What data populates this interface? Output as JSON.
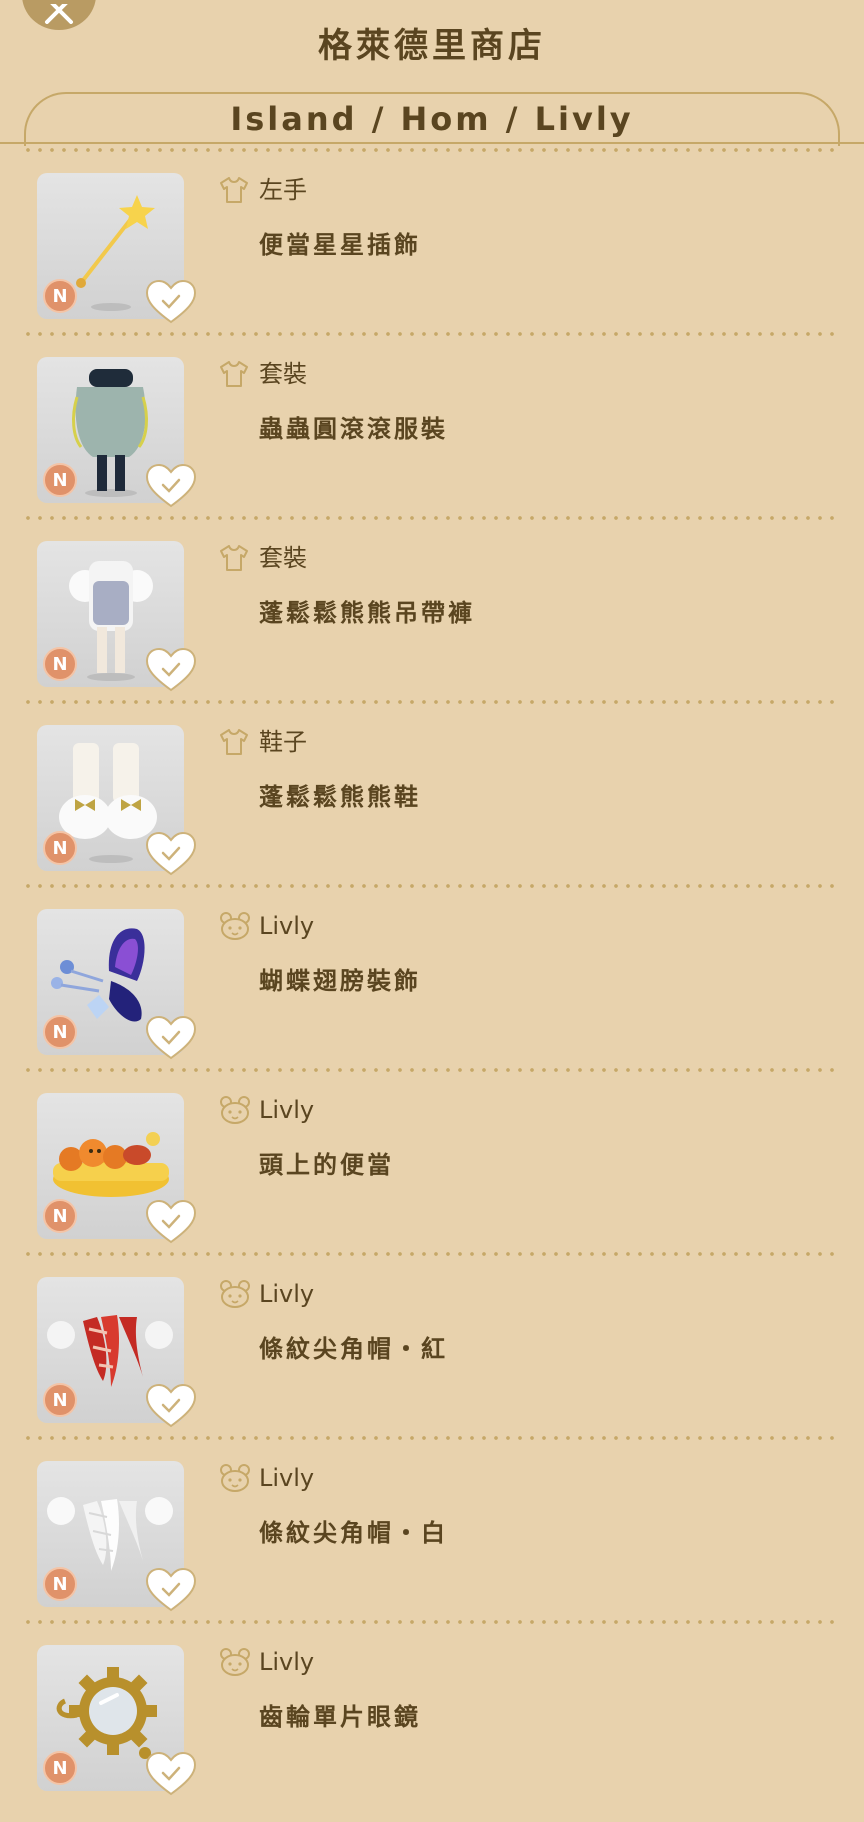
{
  "header": {
    "title": "格萊德里商店",
    "tab_label": "Island / Hom / Livly"
  },
  "rarity_label": "N",
  "items": [
    {
      "category": "左手",
      "category_icon": "shirt-icon",
      "name": "便當星星插飾"
    },
    {
      "category": "套裝",
      "category_icon": "shirt-icon",
      "name": "蟲蟲圓滾滾服裝"
    },
    {
      "category": "套裝",
      "category_icon": "shirt-icon",
      "name": "蓬鬆鬆熊熊吊帶褲"
    },
    {
      "category": "鞋子",
      "category_icon": "shirt-icon",
      "name": "蓬鬆鬆熊熊鞋"
    },
    {
      "category": "Livly",
      "category_icon": "livly-face-icon",
      "name": "蝴蝶翅膀裝飾"
    },
    {
      "category": "Livly",
      "category_icon": "livly-face-icon",
      "name": "頭上的便當"
    },
    {
      "category": "Livly",
      "category_icon": "livly-face-icon",
      "name": "條紋尖角帽・紅"
    },
    {
      "category": "Livly",
      "category_icon": "livly-face-icon",
      "name": "條紋尖角帽・白"
    },
    {
      "category": "Livly",
      "category_icon": "livly-face-icon",
      "name": "齒輪單片眼鏡"
    }
  ],
  "colors": {
    "background": "#e8d2ad",
    "accent": "#c6a868",
    "text": "#5a4520",
    "rarity_badge": "#e0926a"
  }
}
